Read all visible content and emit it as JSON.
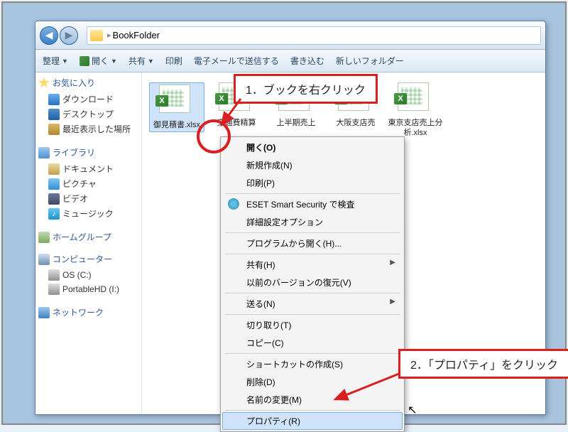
{
  "address": {
    "folder_name": "BookFolder"
  },
  "toolbar": {
    "organize": "整理",
    "open": "開く",
    "share": "共有",
    "print": "印刷",
    "send_email": "電子メールで送信する",
    "burn": "書き込む",
    "new_folder": "新しいフォルダー"
  },
  "sidebar": {
    "favorites": {
      "label": "お気に入り",
      "items": [
        {
          "label": "ダウンロード"
        },
        {
          "label": "デスクトップ"
        },
        {
          "label": "最近表示した場所"
        }
      ]
    },
    "libraries": {
      "label": "ライブラリ",
      "items": [
        {
          "label": "ドキュメント"
        },
        {
          "label": "ピクチャ"
        },
        {
          "label": "ビデオ"
        },
        {
          "label": "ミュージック"
        }
      ]
    },
    "homegroup": {
      "label": "ホームグループ"
    },
    "computer": {
      "label": "コンピューター",
      "items": [
        {
          "label": "OS (C:)"
        },
        {
          "label": "PortableHD (I:)"
        }
      ]
    },
    "network": {
      "label": "ネットワーク"
    }
  },
  "files": [
    {
      "name": "御見積書.xlsx"
    },
    {
      "name": "交通費精算"
    },
    {
      "name": "上半期売上"
    },
    {
      "name": "大阪支店売"
    },
    {
      "name": "東京支店売上分析.xlsx"
    }
  ],
  "context_menu": {
    "open": "開く(O)",
    "new": "新規作成(N)",
    "print": "印刷(P)",
    "eset": "ESET Smart Security で検査",
    "adv_options": "詳細設定オプション",
    "open_with": "プログラムから開く(H)...",
    "share": "共有(H)",
    "restore": "以前のバージョンの復元(V)",
    "send_to": "送る(N)",
    "cut": "切り取り(T)",
    "copy": "コピー(C)",
    "shortcut": "ショートカットの作成(S)",
    "delete": "削除(D)",
    "rename": "名前の変更(M)",
    "properties": "プロパティ(R)"
  },
  "callouts": {
    "c1": "1．ブックを右クリック",
    "c2": "2．「プロパティ」をクリック"
  }
}
